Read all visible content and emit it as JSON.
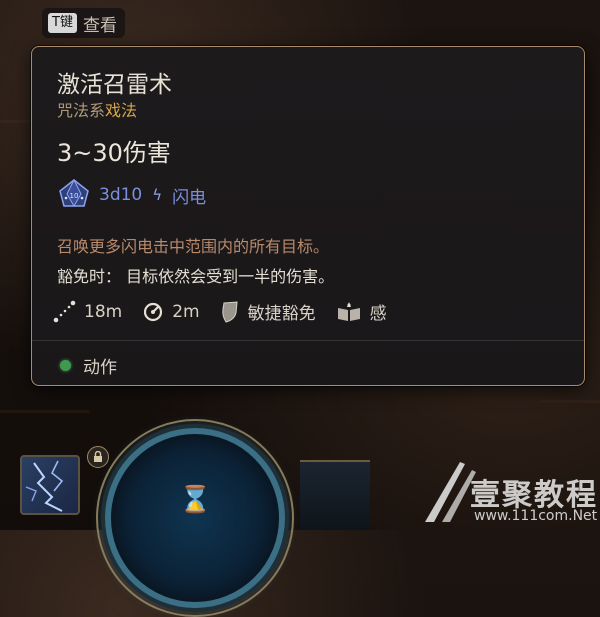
{
  "hint": {
    "key": "T键",
    "label": "查看"
  },
  "tooltip": {
    "title": "激活召雷术",
    "school": "咒法系",
    "tag": "戏法",
    "damage": "3~30伤害",
    "dice": {
      "roll": "3d10",
      "damage_type": "闪电",
      "icon": "d10-dice-icon"
    },
    "description": "召唤更多闪电击中范围内的所有目标。",
    "saving_throw": "豁免时： 目标依然会受到一半的伤害。",
    "stats": [
      {
        "icon": "range-icon",
        "value": "18m"
      },
      {
        "icon": "area-radius-icon",
        "value": "2m"
      },
      {
        "icon": "shield-save-icon",
        "value": "敏捷豁免"
      },
      {
        "icon": "book-icon",
        "value": "感"
      }
    ],
    "cost": {
      "label": "动作",
      "color": "#3e9a4e"
    }
  },
  "hotbar": {
    "center_icon": "hourglass-icon"
  },
  "watermark": {
    "brand": "壹聚教程",
    "url": "www.111com.Net"
  },
  "colors": {
    "border": "#a98c6d",
    "tag": "#d6a64a",
    "dice_text": "#7b8fe0",
    "description": "#b88a6c",
    "action_dot": "#3e9a4e"
  }
}
